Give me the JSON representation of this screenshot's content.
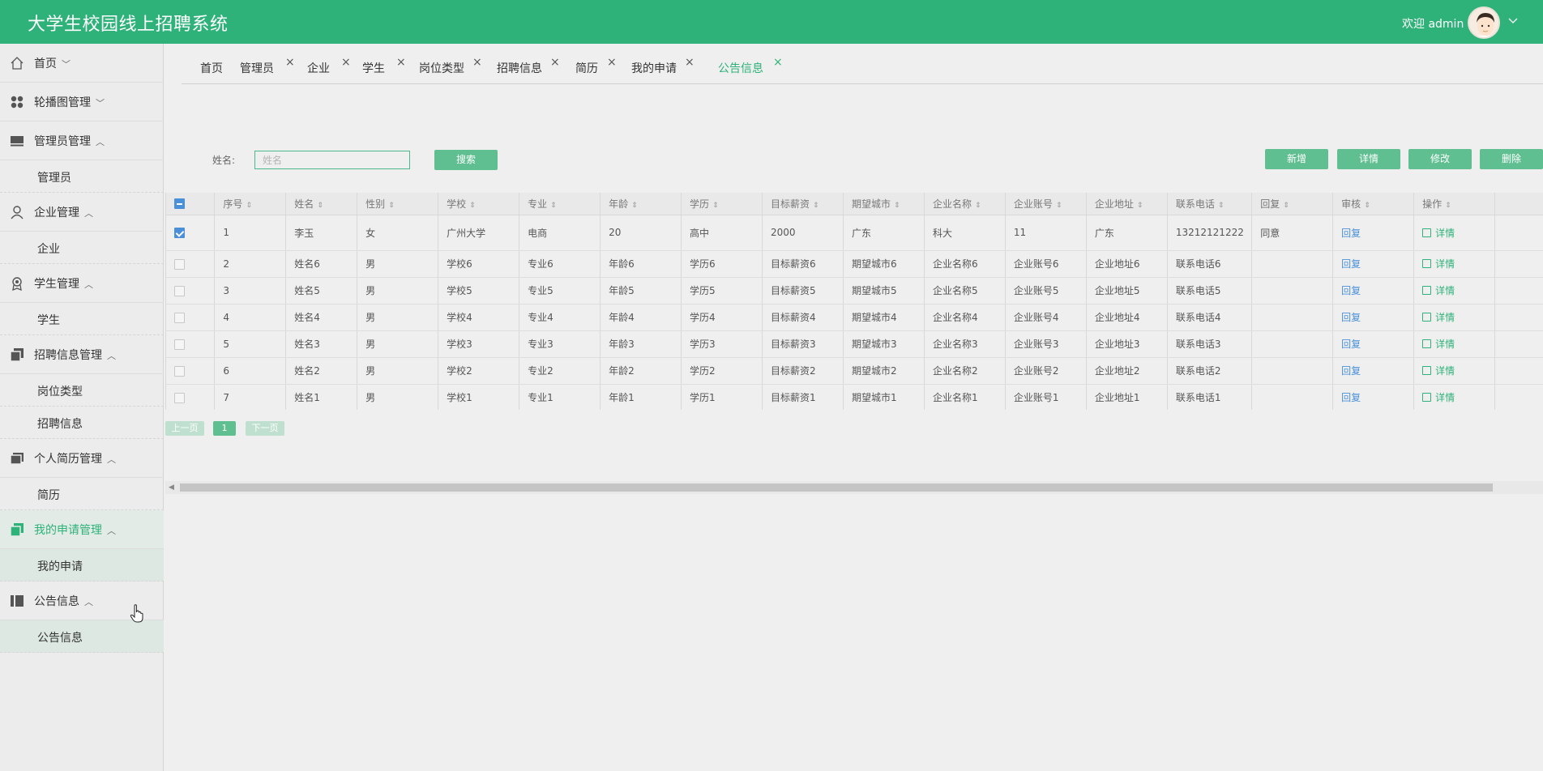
{
  "header": {
    "title": "大学生校园线上招聘系统",
    "welcome": "欢迎 admin"
  },
  "sidebar": {
    "groups": [
      {
        "label": "首页",
        "arrow": "﹀",
        "icon": "home-icon"
      },
      {
        "label": "轮播图管理",
        "arrow": "﹀",
        "icon": "grid-icon"
      },
      {
        "label": "管理员管理",
        "arrow": "︿",
        "icon": "monitor-icon",
        "sub": "管理员"
      },
      {
        "label": "企业管理",
        "arrow": "︿",
        "icon": "user-icon",
        "sub": "企业"
      },
      {
        "label": "学生管理",
        "arrow": "︿",
        "icon": "badge-icon",
        "sub": "学生"
      },
      {
        "label": "招聘信息管理",
        "arrow": "︿",
        "icon": "copy-icon",
        "sub": "岗位类型",
        "sub2": "招聘信息"
      },
      {
        "label": "个人简历管理",
        "arrow": "︿",
        "icon": "folder-icon",
        "sub": "简历"
      },
      {
        "label": "我的申请管理",
        "arrow": "︿",
        "icon": "copy-icon",
        "sub": "我的申请"
      },
      {
        "label": "公告信息",
        "arrow": "︿",
        "icon": "book-icon",
        "sub": "公告信息"
      }
    ]
  },
  "tabs": [
    "首页",
    "管理员",
    "企业",
    "学生",
    "岗位类型",
    "招聘信息",
    "简历",
    "我的申请",
    "公告信息"
  ],
  "search": {
    "label": "姓名:",
    "placeholder": "姓名",
    "button": "搜索"
  },
  "actions": {
    "add": "新增",
    "detail": "详情",
    "edit": "修改",
    "delete": "删除"
  },
  "table": {
    "headers": [
      "序号",
      "姓名",
      "性别",
      "学校",
      "专业",
      "年龄",
      "学历",
      "目标薪资",
      "期望城市",
      "企业名称",
      "企业账号",
      "企业地址",
      "联系电话",
      "回复",
      "审核",
      "操作"
    ],
    "reply_link": "回复",
    "detail_link": "详情",
    "rows": [
      [
        "1",
        "李玉",
        "女",
        "广州大学",
        "电商",
        "20",
        "高中",
        "2000",
        "广东",
        "科大",
        "11",
        "广东",
        "13212121222",
        "同意"
      ],
      [
        "2",
        "姓名6",
        "男",
        "学校6",
        "专业6",
        "年龄6",
        "学历6",
        "目标薪资6",
        "期望城市6",
        "企业名称6",
        "企业账号6",
        "企业地址6",
        "联系电话6",
        ""
      ],
      [
        "3",
        "姓名5",
        "男",
        "学校5",
        "专业5",
        "年龄5",
        "学历5",
        "目标薪资5",
        "期望城市5",
        "企业名称5",
        "企业账号5",
        "企业地址5",
        "联系电话5",
        ""
      ],
      [
        "4",
        "姓名4",
        "男",
        "学校4",
        "专业4",
        "年龄4",
        "学历4",
        "目标薪资4",
        "期望城市4",
        "企业名称4",
        "企业账号4",
        "企业地址4",
        "联系电话4",
        ""
      ],
      [
        "5",
        "姓名3",
        "男",
        "学校3",
        "专业3",
        "年龄3",
        "学历3",
        "目标薪资3",
        "期望城市3",
        "企业名称3",
        "企业账号3",
        "企业地址3",
        "联系电话3",
        ""
      ],
      [
        "6",
        "姓名2",
        "男",
        "学校2",
        "专业2",
        "年龄2",
        "学历2",
        "目标薪资2",
        "期望城市2",
        "企业名称2",
        "企业账号2",
        "企业地址2",
        "联系电话2",
        ""
      ],
      [
        "7",
        "姓名1",
        "男",
        "学校1",
        "专业1",
        "年龄1",
        "学历1",
        "目标薪资1",
        "期望城市1",
        "企业名称1",
        "企业账号1",
        "企业地址1",
        "联系电话1",
        ""
      ]
    ]
  },
  "pager": {
    "prev": "上一页",
    "page": "1",
    "next": "下一页"
  },
  "colors": {
    "primary": "#2eb279",
    "link": "#4a90d9"
  }
}
